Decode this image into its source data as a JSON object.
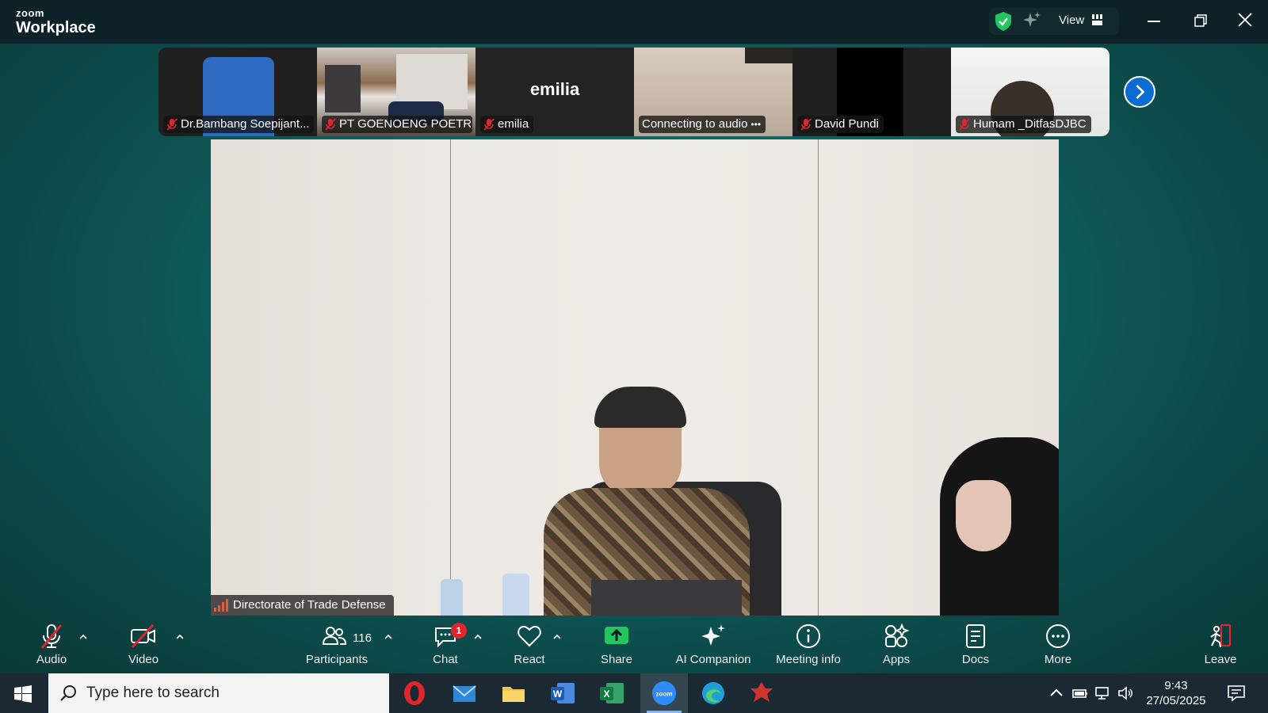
{
  "app": {
    "brand_small": "zoom",
    "brand_big": "Workplace"
  },
  "titlebar": {
    "view_label": "View"
  },
  "participants_strip": [
    {
      "name": "Dr.Bambang Soepijant...",
      "muted": true
    },
    {
      "name": "PT GOENOENG POETR...",
      "muted": true
    },
    {
      "name": "emilia",
      "muted": true,
      "display_name": "emilia"
    },
    {
      "name": "Connecting to audio",
      "muted": false
    },
    {
      "name": "David Pundi",
      "muted": true
    },
    {
      "name": "Humam _DitfasDJBC",
      "muted": true
    }
  ],
  "main_video": {
    "label": "Directorate of Trade Defense"
  },
  "toolbar": {
    "audio": "Audio",
    "video": "Video",
    "participants": "Participants",
    "participants_count": "116",
    "chat": "Chat",
    "chat_badge": "1",
    "react": "React",
    "share": "Share",
    "ai_companion": "AI Companion",
    "meeting_info": "Meeting info",
    "apps": "Apps",
    "docs": "Docs",
    "more": "More",
    "leave": "Leave"
  },
  "taskbar": {
    "search_placeholder": "Type here to search",
    "time": "9:43",
    "date": "27/05/2025"
  },
  "colors": {
    "stage": "#106361",
    "accent_blue": "#0b6cd4",
    "muted_red": "#e0262d",
    "share_green": "#22c55e",
    "leave_red": "#e0262d"
  }
}
